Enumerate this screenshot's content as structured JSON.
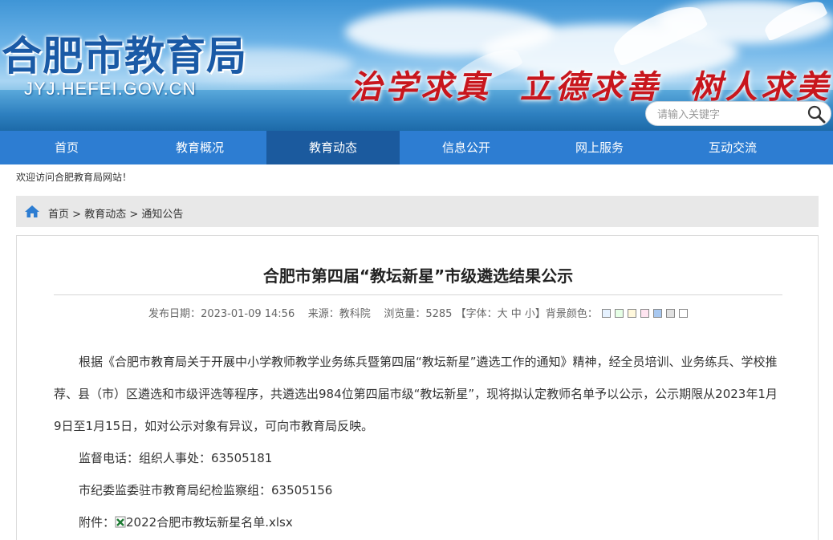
{
  "header": {
    "site_title": "合肥市教育局",
    "site_url": "JYJ.HEFEI.GOV.CN",
    "motto": "治学求真  立德求善  树人求美",
    "search_placeholder": "请输入关键字",
    "search_icon": "magnifier-icon"
  },
  "nav": {
    "items": [
      {
        "label": "首页"
      },
      {
        "label": "教育概况"
      },
      {
        "label": "教育动态"
      },
      {
        "label": "信息公开"
      },
      {
        "label": "网上服务"
      },
      {
        "label": "互动交流"
      }
    ],
    "active_index": 2
  },
  "welcome": "欢迎访问合肥教育局网站！",
  "breadcrumb": {
    "home_icon": "home-icon",
    "home": "首页",
    "sep": ">",
    "level1": "教育动态",
    "level2": "通知公告"
  },
  "article": {
    "title": "合肥市第四届“教坛新星”市级遴选结果公示",
    "meta": {
      "date_label": "发布日期：",
      "date": "2023-01-09 14:56",
      "source_label": "来源：",
      "source": "教科院",
      "views_label": "浏览量：",
      "views": "5285",
      "font_open": "【字体：",
      "font_large": "大",
      "font_mid": "中",
      "font_small": "小",
      "font_close": "】",
      "bg_label": "背景颜色：",
      "bg_colors": [
        "#e6f2ff",
        "#e6ffe6",
        "#fff8dc",
        "#ffe4f0",
        "#a8c8f0",
        "#e0e0e0",
        "#ffffff"
      ]
    },
    "paragraph1": "根据《合肥市教育局关于开展中小学教师教学业务练兵暨第四届“教坛新星”遴选工作的通知》精神，经全员培训、业务练兵、学校推荐、县（市）区遴选和市级评选等程序，共遴选出984位第四届市级“教坛新星”，现将拟认定教师名单予以公示，公示期限从2023年1月9日至1月15日，如对公示对象有异议，可向市教育局反映。",
    "phone_line": "监督电话：组织人事处：63505181",
    "inspection_line": "市纪委监委驻市教育局纪检监察组：63505156",
    "attachment_label": "附件：",
    "attachment_icon": "excel-file-icon",
    "attachment_name": "2022合肥市教坛新星名单.xlsx"
  }
}
